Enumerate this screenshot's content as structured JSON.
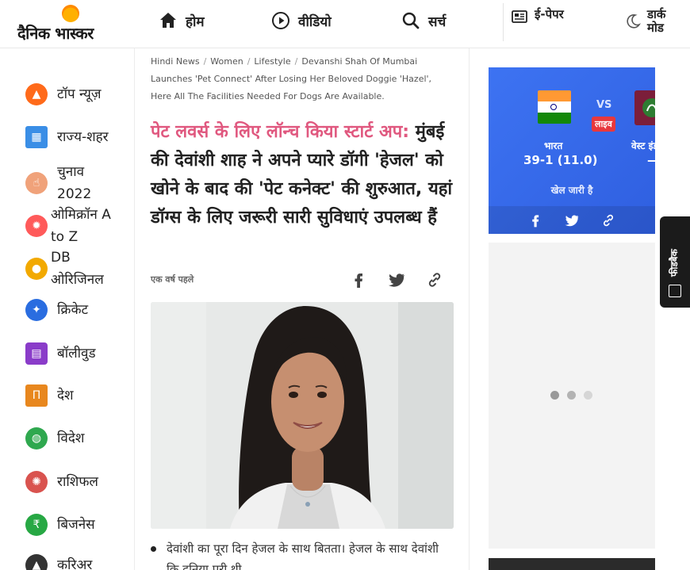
{
  "header": {
    "logo_text": "दैनिक भास्कर",
    "nav": [
      {
        "label": "होम",
        "icon": "home-icon"
      },
      {
        "label": "वीडियो",
        "icon": "play-icon"
      },
      {
        "label": "सर्च",
        "icon": "search-icon"
      }
    ],
    "epaper_label": "ई-पेपर",
    "dark_mode_label": "डार्क मोड"
  },
  "sidebar": {
    "items": [
      {
        "label": "टॉप न्यूज़",
        "icon": "flame-icon",
        "color": "#ff6a1a"
      },
      {
        "label": "राज्य-शहर",
        "icon": "city-icon",
        "color": "#3a8ee6"
      },
      {
        "label": "चुनाव 2022",
        "icon": "vote-finger-icon",
        "color": "#f0a27a"
      },
      {
        "label": "ओमिक्रॉन A to Z",
        "icon": "virus-icon",
        "color": "#ff5a5a"
      },
      {
        "label": "DB ओरिजिनल",
        "icon": "db-original-icon",
        "color": "#f2a900"
      },
      {
        "label": "क्रिकेट",
        "icon": "cricket-icon",
        "color": "#2a6de0"
      },
      {
        "label": "बॉलीवुड",
        "icon": "clapper-icon",
        "color": "#8a3cc9"
      },
      {
        "label": "देश",
        "icon": "india-gate-icon",
        "color": "#e8871e"
      },
      {
        "label": "विदेश",
        "icon": "globe-icon",
        "color": "#2fa84f"
      },
      {
        "label": "राशिफल",
        "icon": "zodiac-icon",
        "color": "#d9534f"
      },
      {
        "label": "बिजनेस",
        "icon": "rupee-icon",
        "color": "#27a844"
      },
      {
        "label": "करिअर",
        "icon": "graduation-cap-icon",
        "color": "#333333"
      }
    ]
  },
  "article": {
    "breadcrumb": [
      "Hindi News",
      "Women",
      "Lifestyle",
      "Devanshi Shah Of Mumbai Launches 'Pet Connect' After Losing Her Beloved Doggie 'Hazel', Here All The Facilities Needed For Dogs Are Available."
    ],
    "headline_highlight": "पेट लवर्स के लिए लॉन्च किया स्टार्ट अप:",
    "headline_rest": "मुंबई की देवांशी शाह ने अपने प्यारे डॉगी 'हेजल' को खोने के बाद की 'पेट कनेक्ट' की शुरुआत, यहां डॉग्स के लिए जरूरी सारी सुविधाएं उपलब्ध हैं",
    "time": "एक वर्ष पहले",
    "bullet": "देवांशी का पूरा दिन हेजल के साथ बितता। हेजल के साथ देवांशी कि दुनिया पूरी थी..."
  },
  "score": {
    "team1": "भारत",
    "team1_score": "39-1 (11.0)",
    "vs": "VS",
    "live": "लाइव",
    "team2": "वेस्ट इंडीज",
    "team2_score": "—",
    "status": "खेल जारी है"
  },
  "feedback_label": "फीडबैक",
  "colors": {
    "accent_pink": "#e0587f",
    "score_blue": "#3d73f2",
    "live_red": "#e8383d"
  }
}
